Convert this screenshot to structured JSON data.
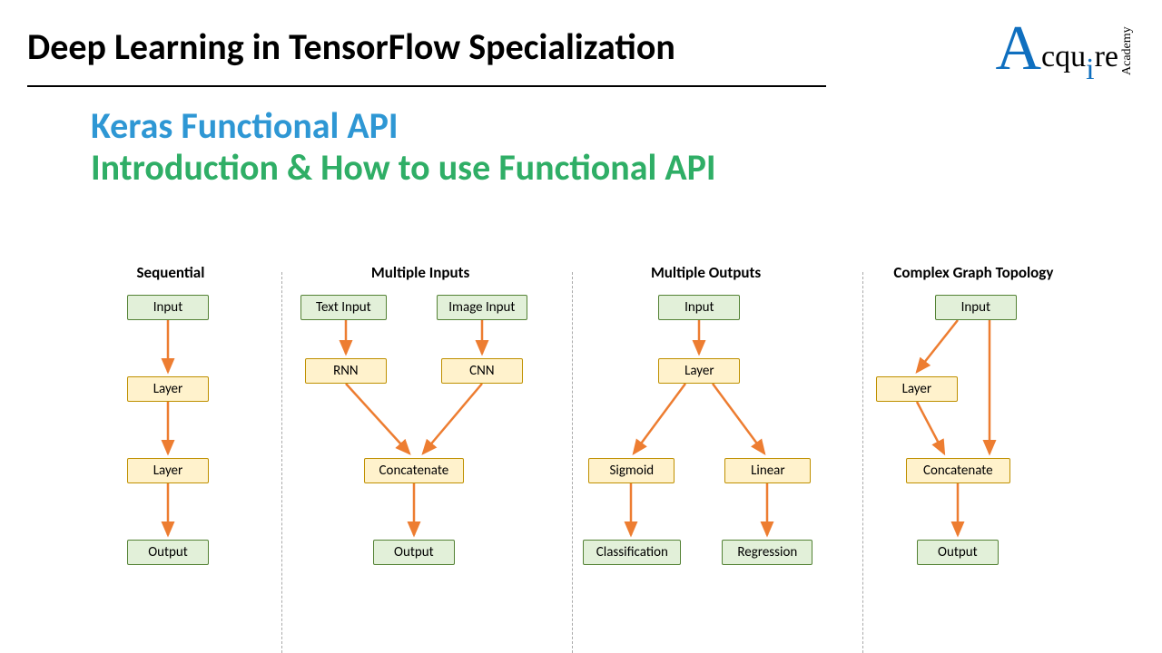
{
  "header": {
    "title": "Deep Learning in TensorFlow Specialization",
    "logo": {
      "a": "A",
      "cqu": "cqu",
      "i": "i",
      "re": "re",
      "academy": "Academy"
    }
  },
  "subtitles": {
    "line1": "Keras Functional API",
    "line2": "Introduction & How to use Functional API"
  },
  "diagrams": {
    "sequential": {
      "title": "Sequential",
      "nodes": {
        "input": "Input",
        "layer1": "Layer",
        "layer2": "Layer",
        "output": "Output"
      }
    },
    "multi_inputs": {
      "title": "Multiple Inputs",
      "nodes": {
        "text": "Text Input",
        "image": "Image Input",
        "rnn": "RNN",
        "cnn": "CNN",
        "concat": "Concatenate",
        "output": "Output"
      }
    },
    "multi_outputs": {
      "title": "Multiple Outputs",
      "nodes": {
        "input": "Input",
        "layer": "Layer",
        "sigmoid": "Sigmoid",
        "linear": "Linear",
        "class": "Classification",
        "regr": "Regression"
      }
    },
    "complex": {
      "title": "Complex Graph Topology",
      "nodes": {
        "input": "Input",
        "layer": "Layer",
        "concat": "Concatenate",
        "output": "Output"
      }
    }
  },
  "colors": {
    "arrow": "#ED7D31"
  }
}
